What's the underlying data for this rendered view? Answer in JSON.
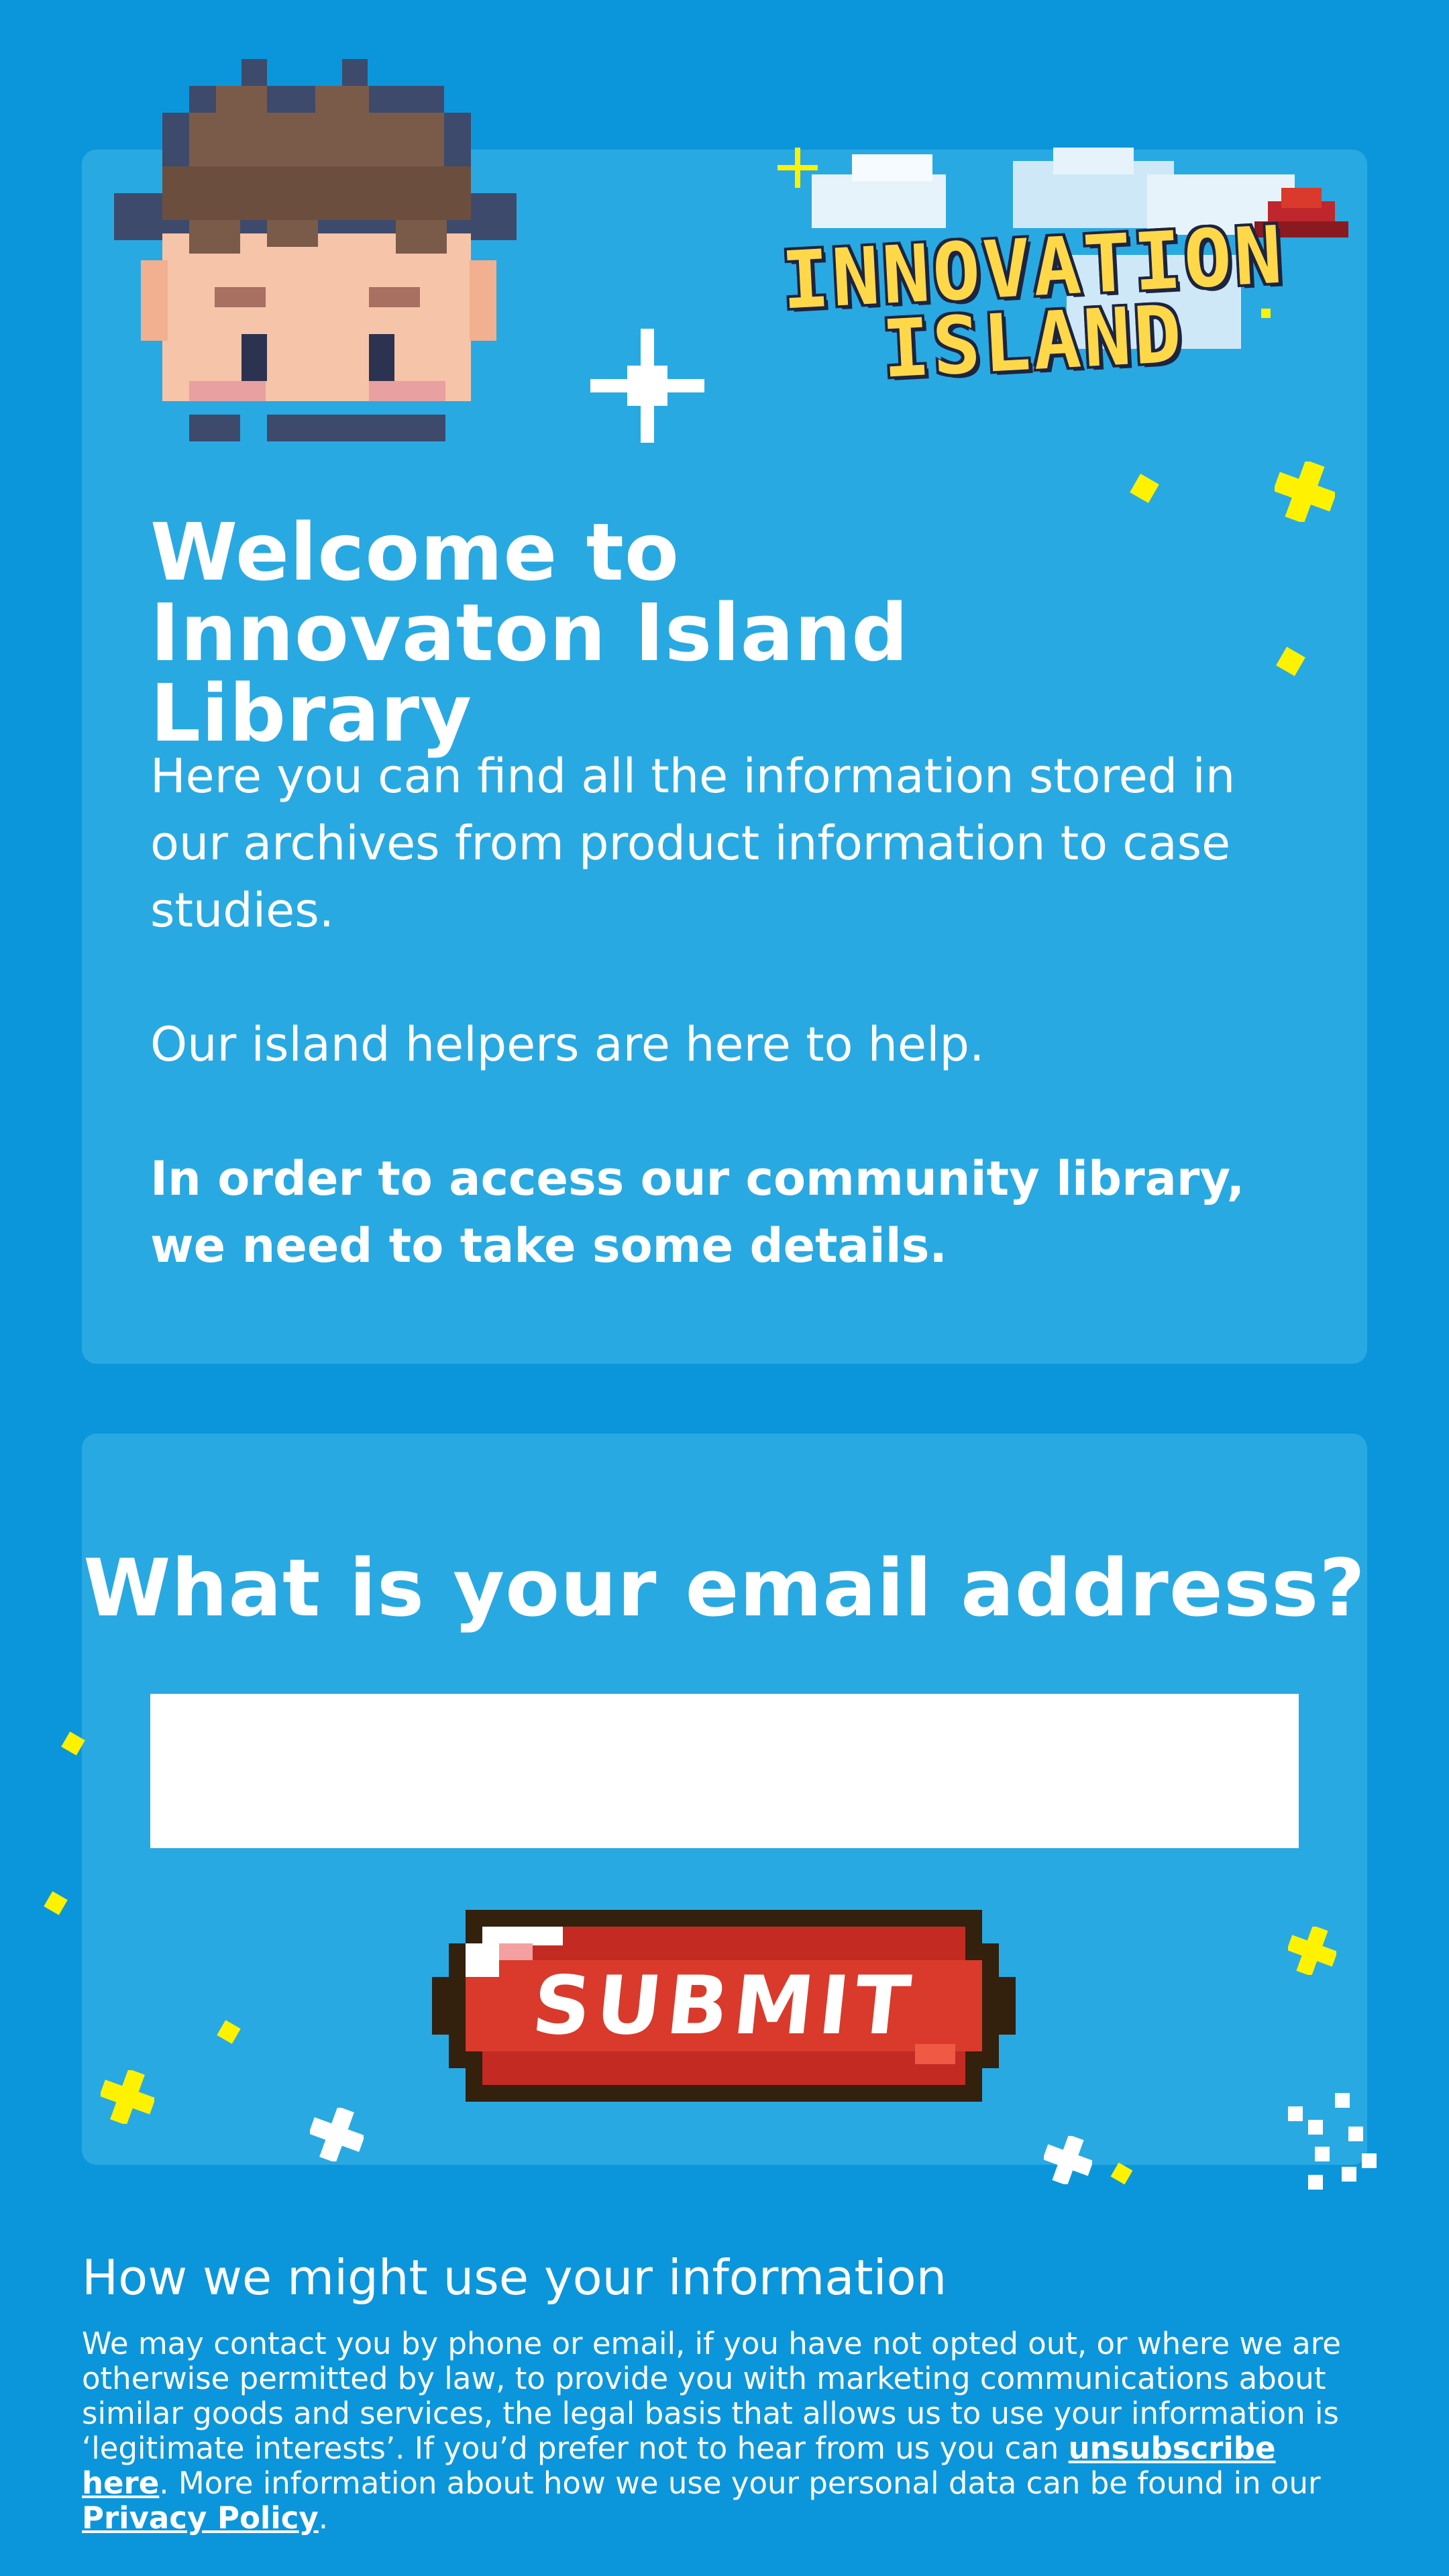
{
  "logo": {
    "line1": "INNOVATION",
    "line2": "ISLAND"
  },
  "intro": {
    "title": "Welcome to Innovaton Island Library",
    "paragraph1": "Here you can find all the information stored in our archives from product information to case studies.",
    "paragraph2": "Our island helpers are here to help.",
    "paragraph3": "In order to access our community library, we need to take some details."
  },
  "email_form": {
    "question": "What is your email address?",
    "input_value": "",
    "submit_label": "SUBMIT"
  },
  "info": {
    "heading": "How we might use your information",
    "text_part1": "We may contact you by phone or email, if you have not opted out, or where we are otherwise permitted by law, to provide you with marketing communications about similar goods and services, the legal basis that allows us to use your information is ‘legitimate interests’. If you’d prefer not to hear from us you can ",
    "unsubscribe_link": "unsubscribe here",
    "text_part2": ". More information about how we use your personal data can be found in our ",
    "privacy_link": "Privacy Policy",
    "text_part3": "."
  },
  "colors": {
    "background": "#0b96db",
    "card": "#29a9e2",
    "submit_red": "#d93a2b",
    "logo_yellow": "#ffd84a",
    "sparkle_yellow": "#fff200"
  },
  "icons": [
    "pixel-avatar-icon",
    "sparkle-icon",
    "cloud-icon",
    "red-hat-icon"
  ]
}
